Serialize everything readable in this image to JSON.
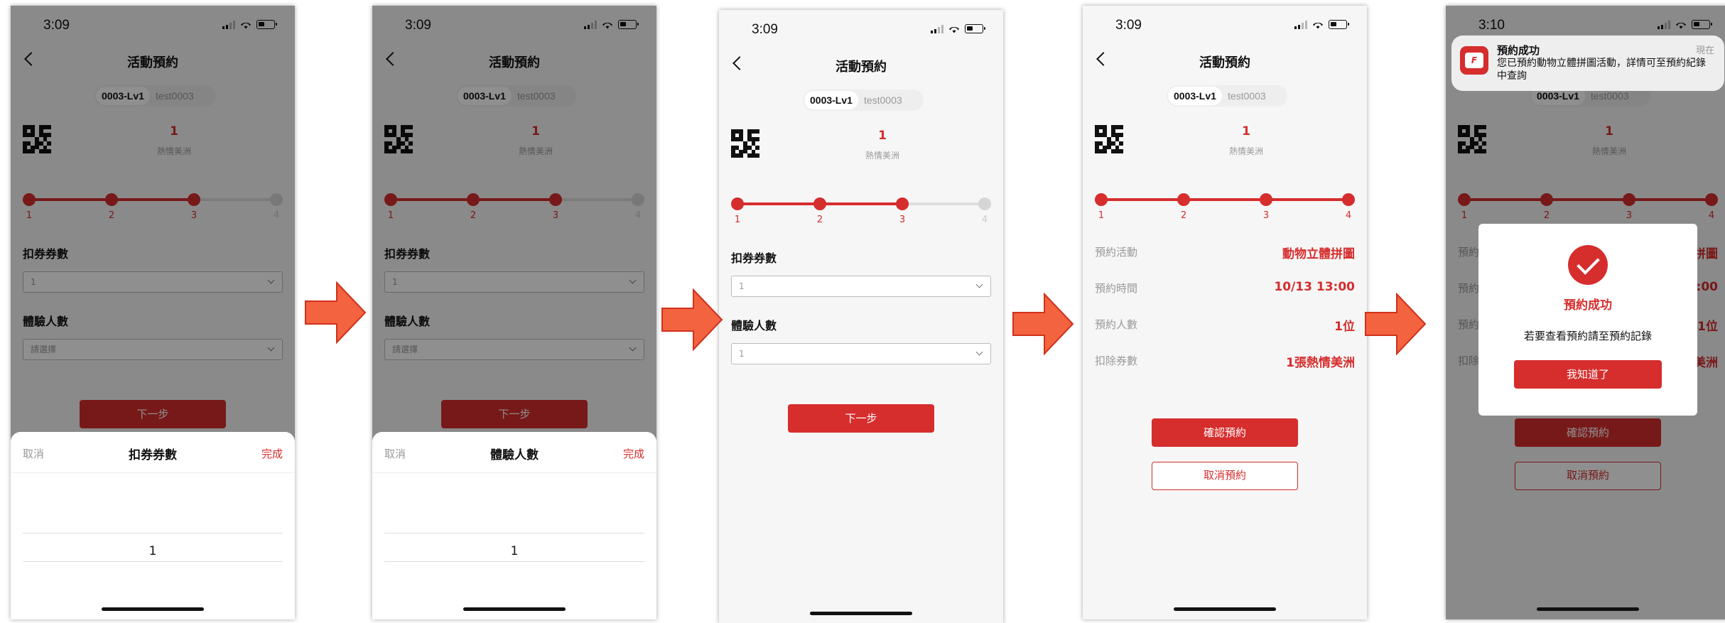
{
  "common": {
    "nav_title": "活動預約",
    "tab_active": "0003-Lv1",
    "tab_inactive": "test0003",
    "level_number": "1",
    "level_name": "熱情美洲",
    "field_coupon_label": "扣券券數",
    "field_people_label": "體驗人數",
    "next_button": "下一步",
    "steps": [
      "1",
      "2",
      "3",
      "4"
    ]
  },
  "colors": {
    "accent": "#d62d2d",
    "arrow": "#f4633f"
  },
  "screen1": {
    "time": "3:09",
    "coupon_value": "1",
    "people_placeholder": "請選擇",
    "sheet": {
      "cancel": "取消",
      "title": "扣券券數",
      "done": "完成",
      "value": "1"
    }
  },
  "screen2": {
    "time": "3:09",
    "coupon_value": "1",
    "people_placeholder": "請選擇",
    "sheet": {
      "cancel": "取消",
      "title": "體驗人數",
      "done": "完成",
      "value": "1"
    }
  },
  "screen3": {
    "time": "3:09",
    "coupon_value": "1",
    "people_value": "1"
  },
  "screen4": {
    "time": "3:09",
    "summary": [
      {
        "label": "預約活動",
        "value": "動物立體拼圖"
      },
      {
        "label": "預約時間",
        "value": "10/13 13:00"
      },
      {
        "label": "預約人數",
        "value": "1位"
      },
      {
        "label": "扣除券數",
        "value": "1張熱情美洲"
      }
    ],
    "confirm_button": "確認預約",
    "cancel_button": "取消預約"
  },
  "screen5": {
    "time": "3:10",
    "notification": {
      "title": "預約成功",
      "time": "現在",
      "body": "您已預約動物立體拼圖活動，詳情可至預約紀錄中查詢"
    },
    "modal": {
      "title": "預約成功",
      "text": "若要查看預約請至預約記錄",
      "button": "我知道了"
    },
    "summary_values": [
      "動物立體拼圖",
      "10/13 13:00",
      "1位",
      "1張熱情美洲"
    ],
    "summary_labels": [
      "預約活動",
      "預約時間",
      "預約人數",
      "扣除券數"
    ],
    "confirm_button": "確認預約",
    "cancel_button": "取消預約"
  }
}
